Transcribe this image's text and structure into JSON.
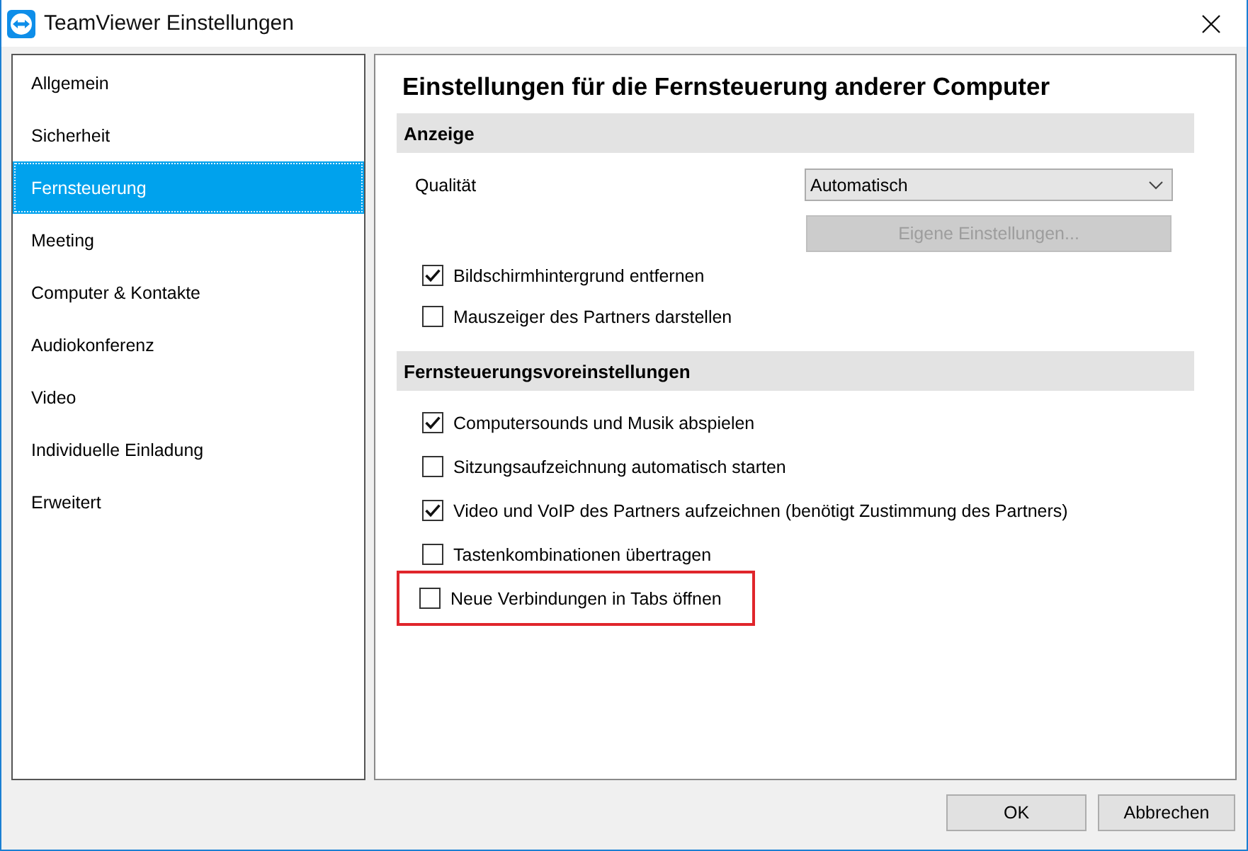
{
  "window": {
    "title": "TeamViewer Einstellungen"
  },
  "sidebar": {
    "items": [
      {
        "label": "Allgemein",
        "selected": false
      },
      {
        "label": "Sicherheit",
        "selected": false
      },
      {
        "label": "Fernsteuerung",
        "selected": true
      },
      {
        "label": "Meeting",
        "selected": false
      },
      {
        "label": "Computer & Kontakte",
        "selected": false
      },
      {
        "label": "Audiokonferenz",
        "selected": false
      },
      {
        "label": "Video",
        "selected": false
      },
      {
        "label": "Individuelle Einladung",
        "selected": false
      },
      {
        "label": "Erweitert",
        "selected": false
      }
    ]
  },
  "content": {
    "heading": "Einstellungen für die Fernsteuerung anderer Computer",
    "sections": [
      {
        "title": "Anzeige",
        "rows": [
          {
            "kind": "select",
            "label": "Qualität",
            "value": "Automatisch"
          },
          {
            "kind": "button",
            "label": "Eigene Einstellungen...",
            "disabled": true
          },
          {
            "kind": "checkbox",
            "label": "Bildschirmhintergrund entfernen",
            "checked": true,
            "highlighted": false
          },
          {
            "kind": "checkbox",
            "label": "Mauszeiger des Partners darstellen",
            "checked": false,
            "highlighted": false
          }
        ]
      },
      {
        "title": "Fernsteuerungsvoreinstellungen",
        "rows": [
          {
            "kind": "checkbox",
            "label": "Computersounds und Musik abspielen",
            "checked": true,
            "highlighted": false
          },
          {
            "kind": "checkbox",
            "label": "Sitzungsaufzeichnung automatisch starten",
            "checked": false,
            "highlighted": false
          },
          {
            "kind": "checkbox",
            "label": "Video und VoIP des Partners aufzeichnen (benötigt Zustimmung des Partners)",
            "checked": true,
            "highlighted": false
          },
          {
            "kind": "checkbox",
            "label": "Tastenkombinationen übertragen",
            "checked": false,
            "highlighted": false
          },
          {
            "kind": "checkbox",
            "label": "Neue Verbindungen in Tabs öffnen",
            "checked": false,
            "highlighted": true
          }
        ]
      }
    ]
  },
  "buttons": [
    {
      "label": "OK"
    },
    {
      "label": "Abbrechen"
    }
  ]
}
